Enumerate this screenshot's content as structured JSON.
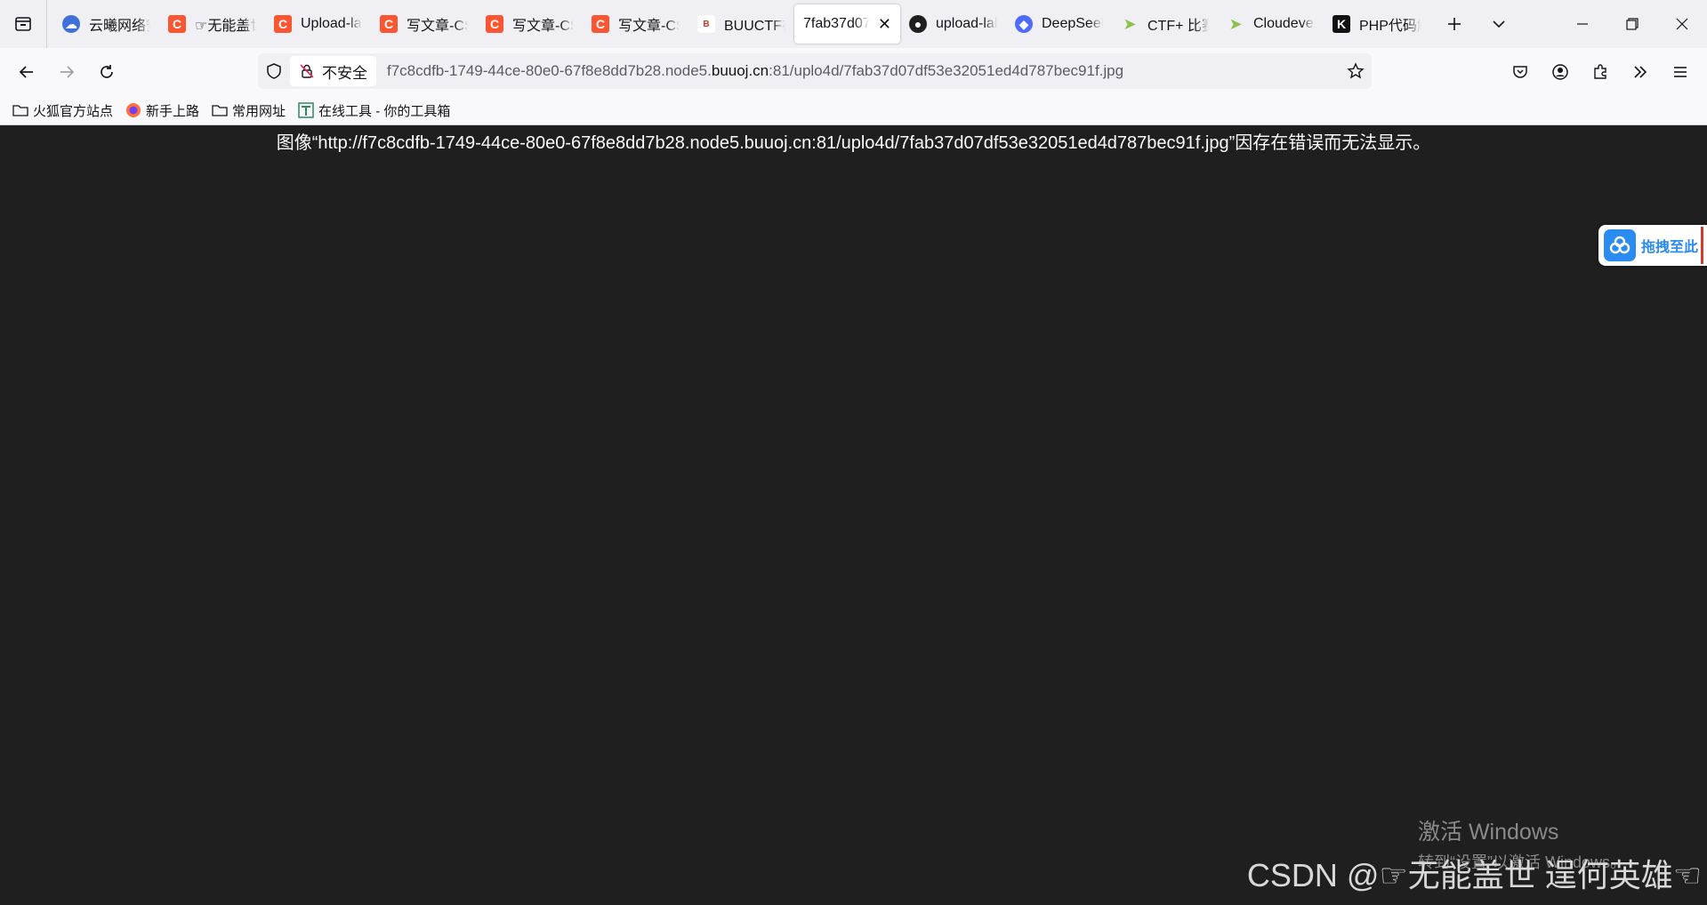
{
  "tabs": [
    {
      "label": "云曦网络安全",
      "icon": "cloud-icon",
      "active": false
    },
    {
      "label": "☞无能盖世",
      "icon": "csdn-icon",
      "active": false
    },
    {
      "label": "Upload-labs",
      "icon": "csdn-icon",
      "active": false
    },
    {
      "label": "写文章-CSDN",
      "icon": "csdn-icon",
      "active": false
    },
    {
      "label": "写文章-CSDN",
      "icon": "csdn-icon",
      "active": false
    },
    {
      "label": "写文章-CSDN",
      "icon": "csdn-icon",
      "active": false
    },
    {
      "label": "BUUCTF在线",
      "icon": "buuctf-icon",
      "active": false
    },
    {
      "label": "7fab37d07",
      "icon": "",
      "active": true
    },
    {
      "label": "upload-labs",
      "icon": "github-icon",
      "active": false
    },
    {
      "label": "DeepSeek",
      "icon": "deepseek-icon",
      "active": false
    },
    {
      "label": "CTF+ 比赛",
      "icon": "ctf-icon",
      "active": false
    },
    {
      "label": "Cloudeven",
      "icon": "ctf-icon",
      "active": false
    },
    {
      "label": "PHP代码解",
      "icon": "k-icon",
      "active": false
    }
  ],
  "navbar": {
    "insecure_label": "不安全",
    "url_prefix": "f7c8cdfb-1749-44ce-80e0-67f8e8dd7b28.node5.",
    "url_domain": "buuoj.cn",
    "url_suffix": ":81/uplo4d/7fab37d07df53e32051ed4d787bec91f.jpg"
  },
  "bookmarks": [
    {
      "label": "火狐官方站点",
      "icon": "folder-icon"
    },
    {
      "label": "新手上路",
      "icon": "firefox-icon"
    },
    {
      "label": "常用网址",
      "icon": "folder-icon"
    },
    {
      "label": "在线工具 - 你的工具箱",
      "icon": "tools-icon"
    }
  ],
  "content": {
    "error_message": "图像“http://f7c8cdfb-1749-44ce-80e0-67f8e8dd7b28.node5.buuoj.cn:81/uplo4d/7fab37d07df53e32051ed4d787bec91f.jpg”因存在错误而无法显示。",
    "float_widget_label": "拖拽至此",
    "activate_title": "激活 Windows",
    "activate_sub": "转到“设置”以激活 Windows。",
    "watermark": "CSDN @☞无能盖世 逞何英雄☜"
  },
  "colors": {
    "content_bg": "#1f1f1f",
    "tabbar_bg": "#f0f0f4",
    "toolbar_bg": "#f9f9fb",
    "csdn_red": "#fc5531",
    "widget_blue": "#2a8cf0"
  }
}
